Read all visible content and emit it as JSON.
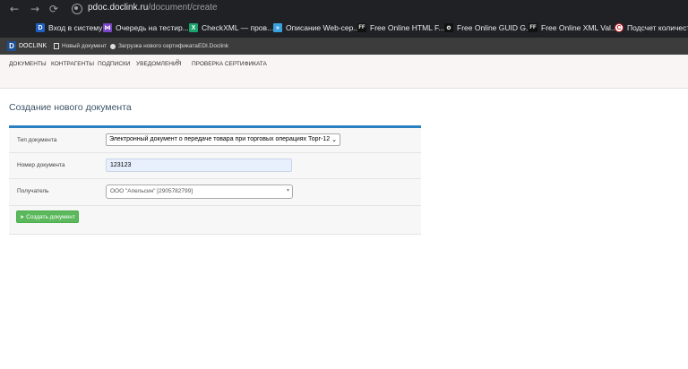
{
  "browser": {
    "back_glyph": "←",
    "forward_glyph": "→",
    "reload_glyph": "⟳",
    "url_host": "pdoc.doclink.ru",
    "url_path": "/document/create",
    "bookmarks": [
      {
        "label": "Вход в систему",
        "icon": "doclink-icon",
        "glyph": "D"
      },
      {
        "label": "Очередь на тестир...",
        "icon": "visual-studio-icon",
        "glyph": "⋈"
      },
      {
        "label": "CheckXML — пров...",
        "icon": "checkxml-icon",
        "glyph": "X"
      },
      {
        "label": "Описание Web-сер...",
        "icon": "arrow-icon",
        "glyph": "»"
      },
      {
        "label": "Free Online HTML F...",
        "icon": "ff-icon",
        "glyph": "FF"
      },
      {
        "label": "Free Online GUID G...",
        "icon": "guid-icon",
        "glyph": "⚙"
      },
      {
        "label": "Free Online XML Val...",
        "icon": "ff-icon",
        "glyph": "FF"
      },
      {
        "label": "Подсчет количеств...",
        "icon": "copyright-icon",
        "glyph": "C"
      }
    ]
  },
  "topbar": {
    "logo_letter": "D",
    "logo_text": "DOCLINK",
    "new_document": "Новый документ",
    "load_certificate": "Загрузка нового сертификата",
    "edi": "EDI.Doclink"
  },
  "submenu": {
    "items": [
      "ДОКУМЕНТЫ",
      "КОНТРАГЕНТЫ",
      "ПОДПИСКИ",
      "УВЕДОМЛЕНИЯ",
      "ПРОВЕРКА СЕРТИФИКАТА"
    ],
    "notifications_count": "0"
  },
  "page": {
    "title": "Создание нового документа"
  },
  "form": {
    "doc_type_label": "Тип документа",
    "doc_type_value": "Электронный документ о передаче товара при торговых операциях Торг-12",
    "doc_number_label": "Номер документа",
    "doc_number_value": "123123",
    "recipient_label": "Получатель",
    "recipient_value": "ООО \"Апельсин\" [2905782799]",
    "create_button": "Создать документ"
  },
  "colors": {
    "accent_blue": "#2a7fc0",
    "button_green": "#5cb85c",
    "topbar_dark": "#3c3c3c",
    "browser_dark": "#202124"
  }
}
